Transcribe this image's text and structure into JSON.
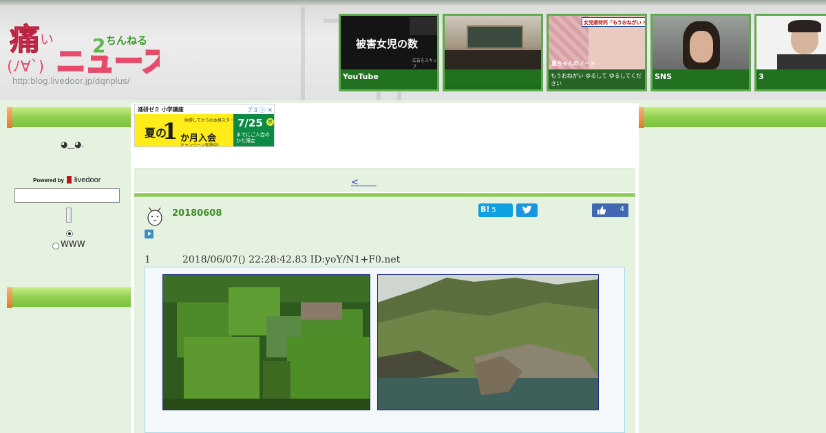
{
  "header": {
    "logo_text": "痛いニュース",
    "logo_sub": "ちんねる",
    "logo_face": "(ﾉ∀`)",
    "logo_url": "http:blog.livedoor.jp/dqnplus/",
    "thumbnails": [
      {
        "caption": "YouTube",
        "image_text": "被害女児の数",
        "image_subtext": "広告をスキップ"
      },
      {
        "caption": ""
      },
      {
        "caption": "",
        "image_text": "女児虐待死「もうおねがい ゆる",
        "image_subtext": "夏ちゃんのノート",
        "image_subtext2": "もうおねがい ゆるして ゆるしてください"
      },
      {
        "caption": "SNS"
      },
      {
        "caption": "3"
      }
    ]
  },
  "sidebar": {
    "face_icon": "face-emoticon",
    "face_link": ".",
    "powered_by": "Powered by",
    "brand": "livedoor",
    "search_value": "",
    "radio_selected": "",
    "radio_www": "WWW"
  },
  "ad": {
    "header": "進研ゼミ 小学講座",
    "icons": "ﾌﾟﾛ ⓘ ✕",
    "big_left": "夏の",
    "big_num": "1",
    "mid": "か月入会",
    "small": "納得してからの本格スタート!",
    "campaign": "キャンペーン実施中!",
    "date": "7/25",
    "day": "水",
    "note": "までにご入会の かた限定"
  },
  "nav": {
    "prev_link": "<　　"
  },
  "article": {
    "date": "20180608",
    "hatena_label": "B!",
    "hatena_count": "5",
    "fb_count": "4",
    "post_number": "1",
    "post_meta": "2018/06/07() 22:28:42.83 ID:yoY/N1+F0.net"
  },
  "colors": {
    "bar_green": "#8fd04f",
    "bar_orange": "#e07c2c",
    "page_bg": "#e6f2e0",
    "date_green": "#3c8c28",
    "link_blue": "#1a36cc"
  }
}
